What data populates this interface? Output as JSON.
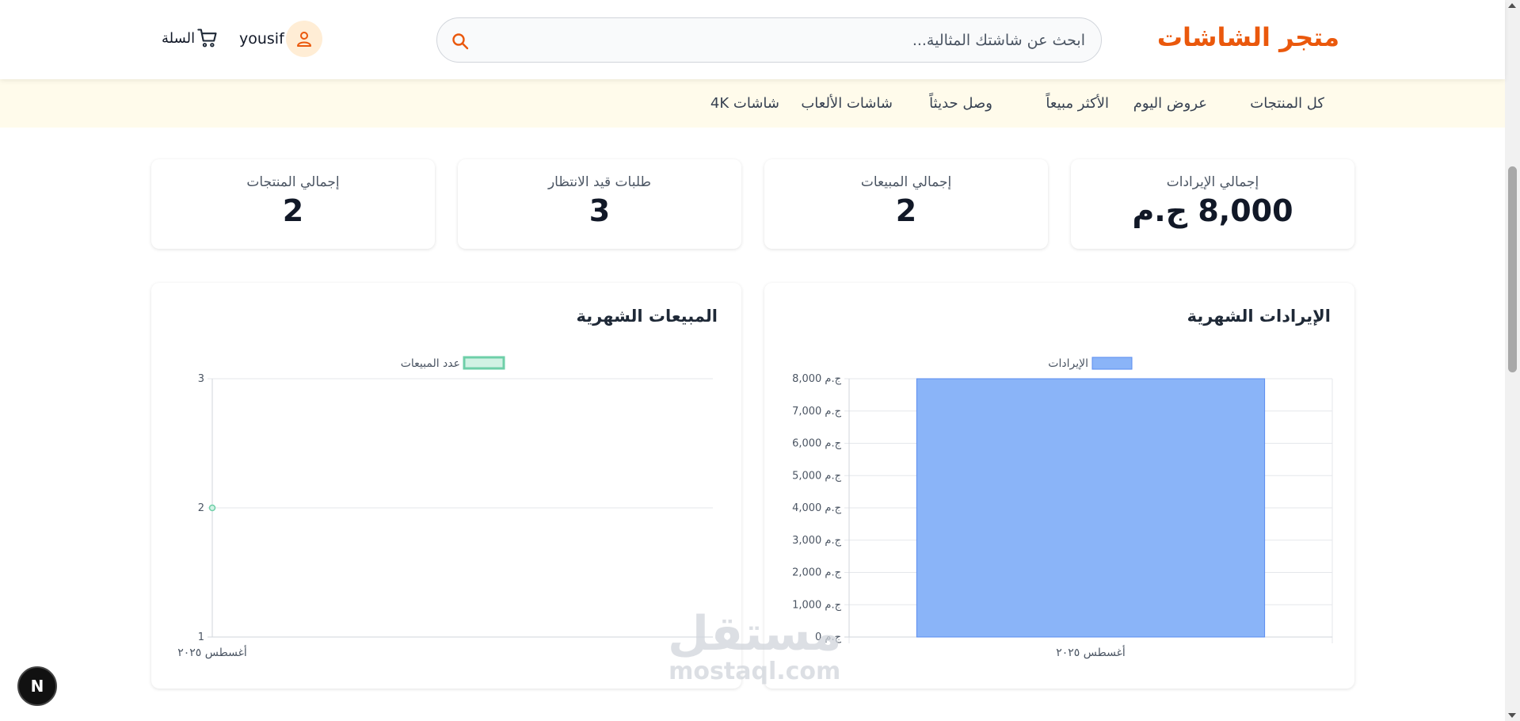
{
  "header": {
    "logo": "متجر الشاشات",
    "search_placeholder": "ابحث عن شاشتك المثالية...",
    "user_name": "yousif",
    "cart_label": "السلة"
  },
  "nav": {
    "items": [
      "كل المنتجات",
      "عروض اليوم",
      "الأكثر مبيعاً",
      "وصل حديثاً",
      "شاشات الألعاب",
      "شاشات 4K"
    ]
  },
  "stats": [
    {
      "label": "إجمالي الإيرادات",
      "value": "8,000 ج.م"
    },
    {
      "label": "إجمالي المبيعات",
      "value": "2"
    },
    {
      "label": "طلبات قيد الانتظار",
      "value": "3"
    },
    {
      "label": "إجمالي المنتجات",
      "value": "2"
    }
  ],
  "revenue_chart": {
    "title": "الإيرادات الشهرية"
  },
  "sales_chart": {
    "title": "المبيعات الشهرية"
  },
  "chart_data": [
    {
      "type": "bar",
      "title": "الإيرادات الشهرية",
      "categories": [
        "أغسطس ٢٠٢٥"
      ],
      "series": [
        {
          "name": "الإيرادات",
          "values": [
            8000
          ]
        }
      ],
      "ylim": [
        0,
        8000
      ],
      "y_ticks": [
        "0 ج.م",
        "1,000 ج.م",
        "2,000 ج.م",
        "3,000 ج.م",
        "4,000 ج.م",
        "5,000 ج.م",
        "6,000 ج.م",
        "7,000 ج.م",
        "8,000 ج.م"
      ],
      "legend": "top",
      "grid": true,
      "color": "#8ab4f8"
    },
    {
      "type": "line",
      "title": "المبيعات الشهرية",
      "categories": [
        "أغسطس ٢٠٢٥"
      ],
      "series": [
        {
          "name": "عدد المبيعات",
          "values": [
            2
          ]
        }
      ],
      "ylim": [
        1,
        3
      ],
      "y_ticks": [
        "1",
        "2",
        "3"
      ],
      "legend": "top",
      "grid": true,
      "color": "#6ecfa8"
    }
  ],
  "badge": "N",
  "watermark": {
    "main": "مستقل",
    "sub": "mostaql.com"
  },
  "colors": {
    "accent": "#ea580c",
    "nav_bg": "#fffbeb",
    "bar": "#8ab4f8",
    "line": "#6ecfa8"
  }
}
